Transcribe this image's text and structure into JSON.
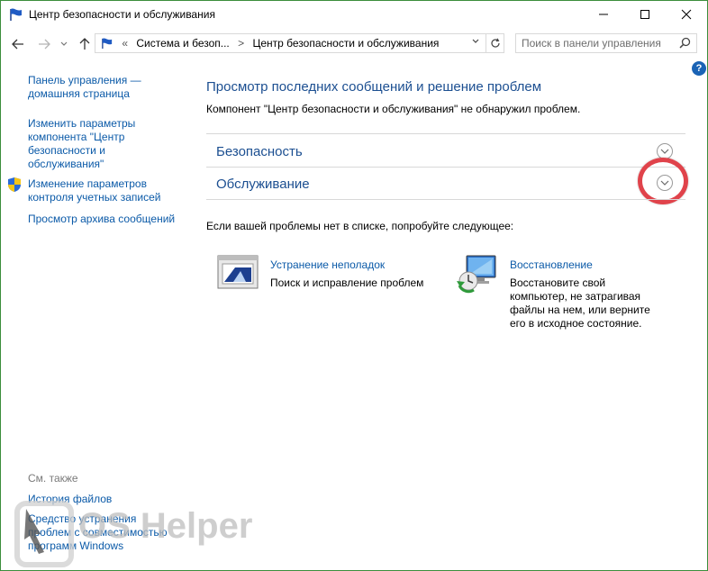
{
  "window": {
    "title": "Центр безопасности и обслуживания",
    "controls": [
      "minimize",
      "maximize",
      "close"
    ]
  },
  "address": {
    "overflow": "«",
    "crumbs": [
      "Система и безоп...",
      "Центр безопасности и обслуживания"
    ],
    "separator": ">"
  },
  "search": {
    "placeholder": "Поиск в панели управления"
  },
  "help": {
    "label": "?"
  },
  "sidebar": {
    "home_line1": "Панель управления —",
    "home_line2": "домашняя страница",
    "settings_line1": "Изменить параметры",
    "settings_line2": "компонента \"Центр",
    "settings_line3": "безопасности и",
    "settings_line4": "обслуживания\"",
    "uac_line1": "Изменение параметров",
    "uac_line2": "контроля учетных записей",
    "archive": "Просмотр архива сообщений",
    "see_also": "См. также",
    "file_history": "История файлов",
    "compat_line1": "Средство устранения",
    "compat_line2": "проблем с совместимостью",
    "compat_line3": "программ Windows"
  },
  "main": {
    "heading": "Просмотр последних сообщений и решение проблем",
    "subtitle": "Компонент \"Центр безопасности и обслуживания\" не обнаружил проблем.",
    "sections": [
      "Безопасность",
      "Обслуживание"
    ],
    "hint": "Если вашей проблемы нет в списке, попробуйте следующее:",
    "tools": [
      {
        "title": "Устранение неполадок",
        "desc": [
          "Поиск и исправление проблем"
        ]
      },
      {
        "title": "Восстановление",
        "desc": [
          "Восстановите свой",
          "компьютер, не затрагивая",
          "файлы на нем, или верните",
          "его в исходное состояние."
        ]
      }
    ]
  },
  "watermark": {
    "text": "OS Helper"
  },
  "colors": {
    "link": "#0b5aa8",
    "heading": "#1c4f91",
    "highlight_ring": "#e0434b",
    "window_border": "#3c8d3c"
  }
}
